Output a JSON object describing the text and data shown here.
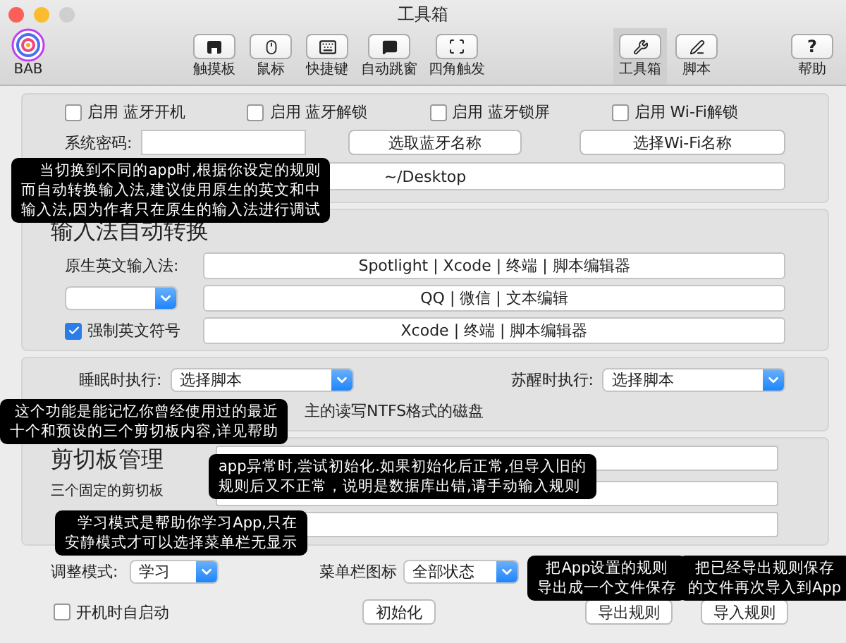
{
  "window": {
    "title": "工具箱"
  },
  "toolbar": {
    "app_label": "BAB",
    "items": [
      {
        "label": "触摸板",
        "kind": "trackpad",
        "selected": false
      },
      {
        "label": "鼠标",
        "kind": "mouse",
        "selected": false
      },
      {
        "label": "快捷键",
        "kind": "keyboard",
        "selected": false
      },
      {
        "label": "自动跳窗",
        "kind": "bubble",
        "selected": false
      },
      {
        "label": "四角触发",
        "kind": "corners",
        "selected": false
      }
    ],
    "tools": [
      {
        "label": "工具箱",
        "kind": "tools",
        "selected": true
      },
      {
        "label": "脚本",
        "kind": "pen",
        "selected": false
      }
    ],
    "help": {
      "symbol": "?",
      "label": "帮助"
    }
  },
  "device": {
    "toggles": [
      {
        "label": "启用  蓝牙开机",
        "checked": false
      },
      {
        "label": "启用  蓝牙解锁",
        "checked": false
      },
      {
        "label": "启用  蓝牙锁屏",
        "checked": false
      },
      {
        "label": "启用  Wi-Fi解锁",
        "checked": false
      }
    ],
    "password_label": "系统密码:",
    "buttons": [
      "选取蓝牙名称",
      "选择Wi-Fi名称"
    ],
    "path": "~/Desktop"
  },
  "input_method": {
    "title": "输入法自动转换",
    "rows": [
      {
        "kind": "label",
        "label": "原生英文输入法:",
        "apps": "Spotlight | Xcode | 终端 | 脚本编辑器"
      },
      {
        "kind": "select",
        "apps": "QQ | 微信 | 文本编辑"
      },
      {
        "kind": "checkbox",
        "label": "强制英文符号",
        "checked": true,
        "apps": "Xcode | 终端 | 脚本编辑器"
      }
    ]
  },
  "power": {
    "selects": [
      {
        "label": "睡眠时执行:",
        "value": "选择脚本"
      },
      {
        "label": "苏醒时执行:",
        "value": "选择脚本"
      }
    ],
    "ntfs_text": "主的读写NTFS格式的磁盘"
  },
  "clipboard": {
    "title": "剪切板管理",
    "label": "三个固定的剪切板"
  },
  "footer": {
    "mode": {
      "label": "调整模式:",
      "value": "学习"
    },
    "menu_icon": {
      "label": "菜单栏图标",
      "value": "全部状态"
    },
    "autostart": {
      "label": "开机时自启动",
      "checked": false
    },
    "buttons": [
      "初始化",
      "导出规则",
      "导入规则"
    ]
  },
  "callouts": [
    {
      "lines": [
        "当切换到不同的app时,根据你设定的规则",
        "而自动转换输入法,建议使用原生的英文和中",
        "输入法,因为作者只在原生的输入法进行调试"
      ]
    },
    {
      "lines": [
        "这个功能是能记忆你曾经使用过的最近",
        "十个和预设的三个剪切板内容,详见帮助"
      ]
    },
    {
      "lines": [
        "app异常时,尝试初始化.如果初始化后正常,但导入旧的",
        "规则后又不正常，说明是数据库出错,请手动输入规则"
      ]
    },
    {
      "lines": [
        "学习模式是帮助你学习App,只在",
        "安静模式才可以选择菜单栏无显示"
      ]
    },
    {
      "lines": [
        "把App设置的规则",
        "导出成一个文件保存"
      ]
    },
    {
      "lines": [
        "把已经导出规则保存",
        "的文件再次导入到App"
      ]
    }
  ]
}
